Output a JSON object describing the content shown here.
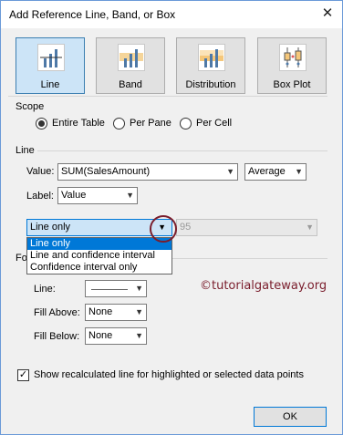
{
  "window": {
    "title": "Add Reference Line, Band, or Box",
    "close_glyph": "✕"
  },
  "types": [
    {
      "label": "Line",
      "icon": "reference-line-icon",
      "selected": true
    },
    {
      "label": "Band",
      "icon": "reference-band-icon",
      "selected": false
    },
    {
      "label": "Distribution",
      "icon": "distribution-icon",
      "selected": false
    },
    {
      "label": "Box Plot",
      "icon": "box-plot-icon",
      "selected": false
    }
  ],
  "scope": {
    "label": "Scope",
    "options": [
      {
        "label": "Entire Table",
        "selected": true
      },
      {
        "label": "Per Pane",
        "selected": false
      },
      {
        "label": "Per Cell",
        "selected": false
      }
    ]
  },
  "line": {
    "label": "Line",
    "value_label": "Value:",
    "value_field": "SUM(SalesAmount)",
    "aggregation": "Average",
    "label_label": "Label:",
    "label_value": "Value"
  },
  "confidence": {
    "selected": "Line only",
    "percent": "95",
    "options": [
      {
        "label": "Line only",
        "selected": true
      },
      {
        "label": "Line and confidence interval",
        "selected": false
      },
      {
        "label": "Confidence interval only",
        "selected": false
      }
    ]
  },
  "formatting": {
    "label_partial": "Fo",
    "line_label": "Line:",
    "fill_above_label": "Fill Above:",
    "fill_above_value": "None",
    "fill_below_label": "Fill Below:",
    "fill_below_value": "None"
  },
  "watermark": "©tutorialgateway.org",
  "recalc": {
    "label": "Show recalculated line for highlighted or selected data points",
    "checked": true
  },
  "ok_label": "OK",
  "colors": {
    "selected_blue": "#0078d7",
    "annotation": "#7a1d2c"
  }
}
